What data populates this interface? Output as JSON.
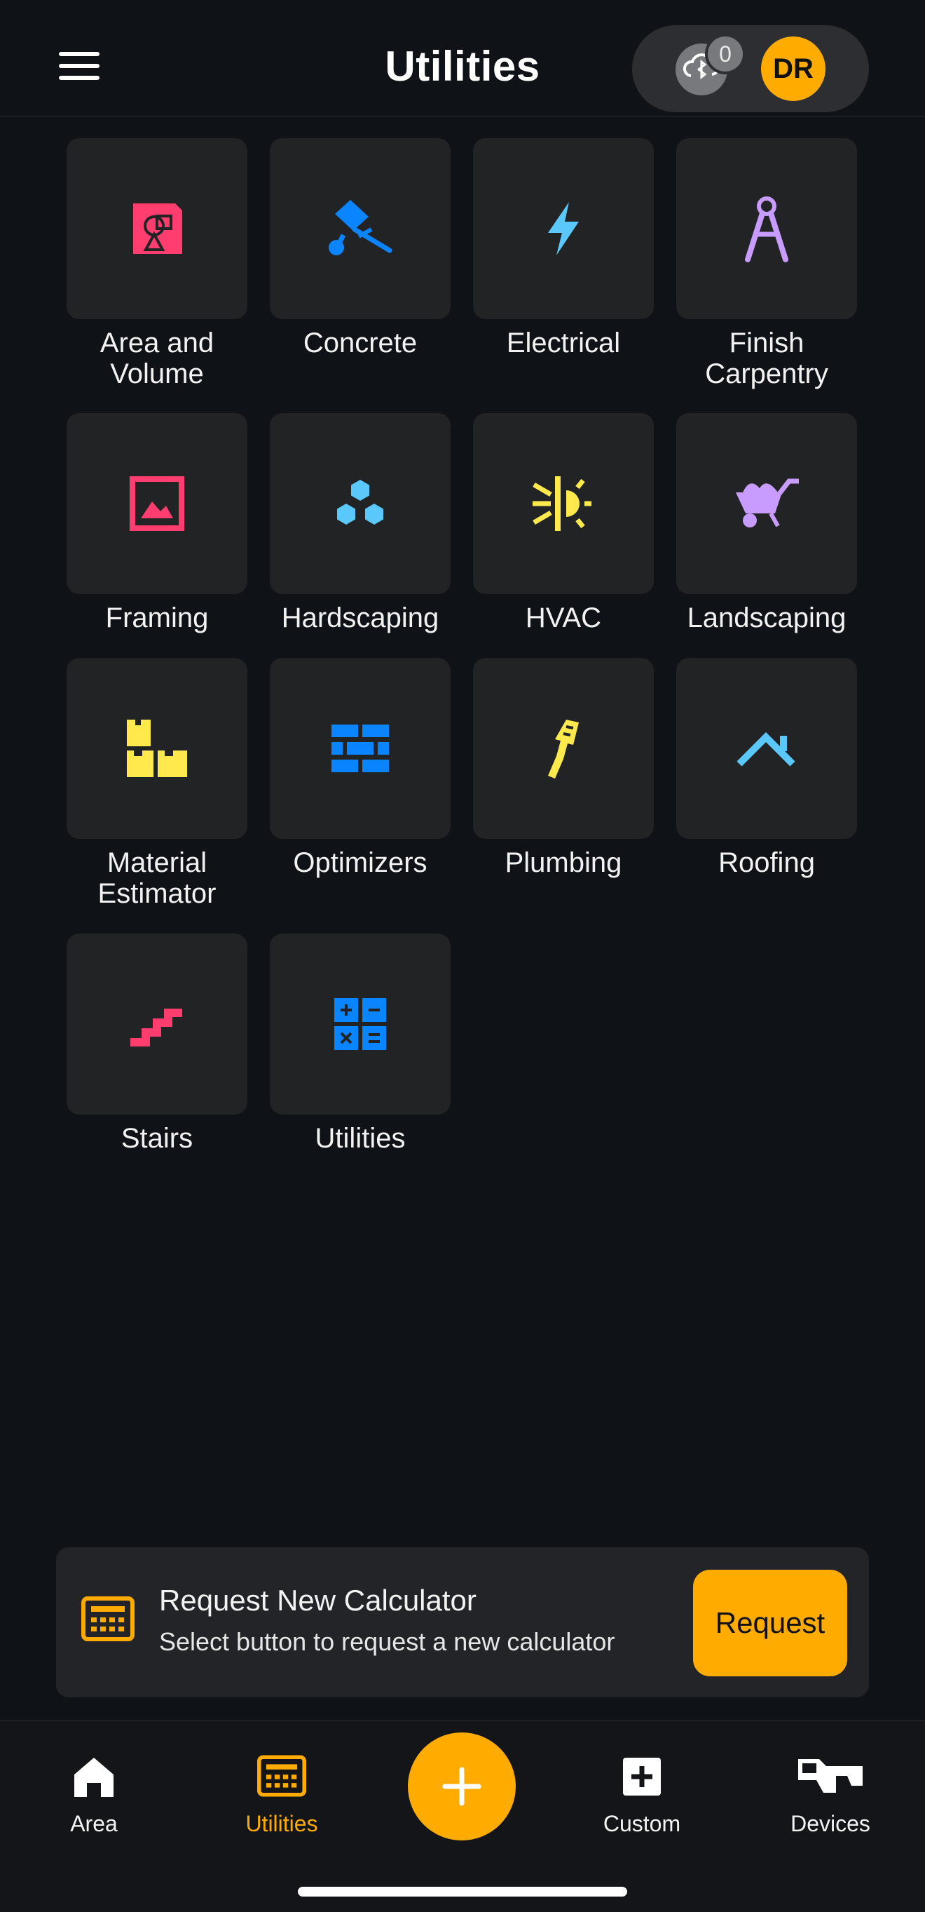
{
  "header": {
    "title": "Utilities",
    "sync_count": "0",
    "avatar_initials": "DR"
  },
  "categories": [
    {
      "label": "Area and\nVolume",
      "icon": "area-volume-icon",
      "color": "#ff3d6e"
    },
    {
      "label": "Concrete",
      "icon": "concrete-mixer-icon",
      "color": "#0a84ff"
    },
    {
      "label": "Electrical",
      "icon": "lightning-icon",
      "color": "#5ac8fa"
    },
    {
      "label": "Finish\nCarpentry",
      "icon": "compass-icon",
      "color": "#c89bff"
    },
    {
      "label": "Framing",
      "icon": "picture-frame-icon",
      "color": "#ff3d6e"
    },
    {
      "label": "Hardscaping",
      "icon": "hexagons-icon",
      "color": "#5ac8fa"
    },
    {
      "label": "HVAC",
      "icon": "hvac-sun-icon",
      "color": "#ffe94d"
    },
    {
      "label": "Landscaping",
      "icon": "wheelbarrow-icon",
      "color": "#c89bff"
    },
    {
      "label": "Material\nEstimator",
      "icon": "boxes-icon",
      "color": "#ffe94d"
    },
    {
      "label": "Optimizers",
      "icon": "bricks-icon",
      "color": "#0a84ff"
    },
    {
      "label": "Plumbing",
      "icon": "pipe-wrench-icon",
      "color": "#ffe94d"
    },
    {
      "label": "Roofing",
      "icon": "roof-icon",
      "color": "#5ac8fa"
    },
    {
      "label": "Stairs",
      "icon": "stairs-icon",
      "color": "#ff3d6e"
    },
    {
      "label": "Utilities",
      "icon": "calculator-icon",
      "color": "#0a84ff"
    }
  ],
  "request_card": {
    "title": "Request New Calculator",
    "subtitle": "Select button to request a new calculator",
    "button_label": "Request"
  },
  "bottom_nav": {
    "items": [
      {
        "label": "Area",
        "icon": "home-icon"
      },
      {
        "label": "Utilities",
        "icon": "calculator-icon",
        "active": true
      },
      {
        "label": "Custom",
        "icon": "plus-square-icon"
      },
      {
        "label": "Devices",
        "icon": "devices-icon"
      }
    ]
  },
  "colors": {
    "accent": "#ffab00",
    "background": "#0f1216",
    "tile": "#222325"
  }
}
